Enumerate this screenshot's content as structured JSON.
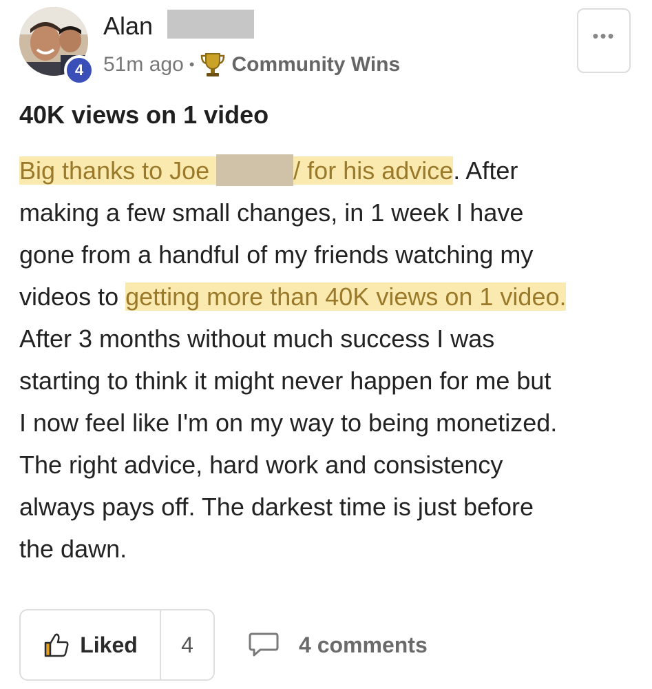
{
  "post": {
    "author": {
      "name": "Alan",
      "level": "4"
    },
    "time": "51m ago",
    "separator": "•",
    "category": "Community Wins",
    "more_icon": "more-horizontal-icon",
    "title": "40K views on 1 video",
    "body": {
      "line1_hl_a": "Big thanks to Joe ",
      "line1_hl_b": "/ for his advice",
      "line1_rest": ". After",
      "line2": "making a few small changes, in 1 week I have",
      "line3": "gone from a handful of my friends watching my",
      "line4_plain": "videos to ",
      "line4_hl": "getting more than 40K views on 1 video.",
      "line5": "After 3 months without much success I was",
      "line6": "starting to think it might never happen for me but",
      "line7": "I now feel like I'm on my way to being monetized.",
      "line8": "The right advice, hard work and consistency",
      "line9": "always pays off. The darkest time is just before",
      "line10": "the dawn."
    },
    "reactions": {
      "like_label": "Liked",
      "like_count": "4",
      "comments_label": "4 comments"
    }
  },
  "colors": {
    "level_badge": "#3b4fb8",
    "highlight_bg": "#fbeab0",
    "highlight_text": "#9a7a2a",
    "trophy": "#c9a227"
  }
}
